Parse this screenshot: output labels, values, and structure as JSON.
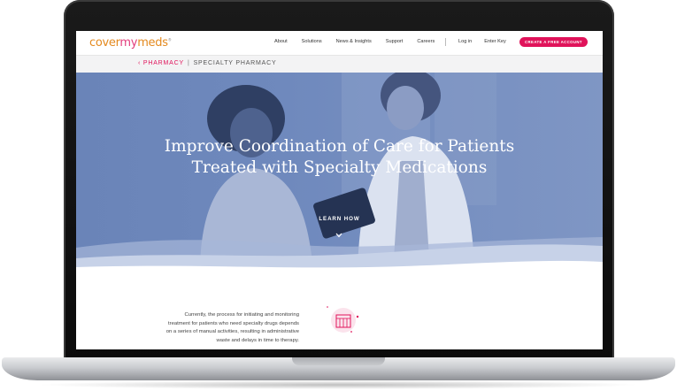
{
  "brand": {
    "logo_cover": "cover",
    "logo_my": "my",
    "logo_meds": "meds",
    "primary_color": "#e0135a",
    "logo_color": "#e48a1f",
    "hero_color": "#6f89bd"
  },
  "nav": {
    "items": [
      {
        "label": "About"
      },
      {
        "label": "Solutions"
      },
      {
        "label": "News & Insights"
      },
      {
        "label": "Support"
      },
      {
        "label": "Careers"
      }
    ],
    "login_label": "Log in",
    "enter_key_label": "Enter Key",
    "cta_label": "CREATE A FREE ACCOUNT"
  },
  "breadcrumb": {
    "parent": "‹ PHARMACY",
    "separator": "|",
    "current": "SPECIALTY PHARMACY"
  },
  "hero": {
    "title_line1": "Improve Coordination of Care for Patients",
    "title_line2": "Treated with Specialty Medications",
    "learn_how_label": "LEARN HOW",
    "chevron_icon": "chevron-down-icon"
  },
  "content": {
    "intro_line1": "Currently, the process for initiating and monitoring",
    "intro_line2": "treatment for patients who need specialty drugs depends",
    "intro_line3": "on a series of manual activities, resulting in administrative",
    "intro_line4": "waste and delays in time to therapy.",
    "icon": "pharmacy-building-icon"
  }
}
